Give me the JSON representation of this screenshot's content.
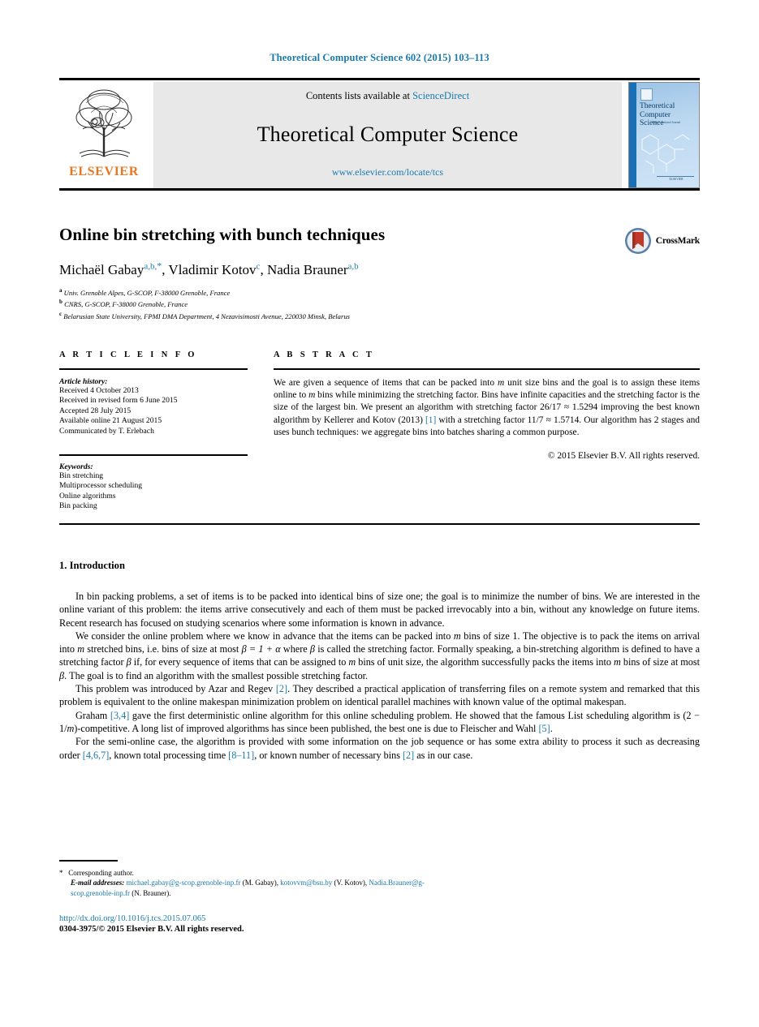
{
  "running_head": "Theoretical Computer Science 602 (2015) 103–113",
  "masthead": {
    "publisher": "ELSEVIER",
    "contents_prefix": "Contents lists available at",
    "contents_link": "ScienceDirect",
    "journal_name": "Theoretical Computer Science",
    "journal_url": "www.elsevier.com/locate/tcs",
    "cover": {
      "title_line1": "Theoretical",
      "title_line2": "Computer Science",
      "subtitle": "An International Journal",
      "footer": "ELSEVIER"
    }
  },
  "article": {
    "title": "Online bin stretching with bunch techniques",
    "authors": [
      {
        "name": "Michaël Gabay",
        "marks": "a,b,",
        "star": "*",
        "sep": ", "
      },
      {
        "name": "Vladimir Kotov",
        "marks": "c",
        "star": "",
        "sep": ", "
      },
      {
        "name": "Nadia Brauner",
        "marks": "a,b",
        "star": "",
        "sep": ""
      }
    ],
    "affiliations": [
      {
        "mark": "a",
        "text": "Univ. Grenoble Alpes, G-SCOP, F-38000 Grenoble, France"
      },
      {
        "mark": "b",
        "text": "CNRS, G-SCOP, F-38000 Grenoble, France"
      },
      {
        "mark": "c",
        "text": "Belarusian State University, FPMI DMA Department, 4 Nezavisimosti Avenue, 220030 Minsk, Belarus"
      }
    ],
    "crossmark_label": "CrossMark"
  },
  "info": {
    "heading": "A R T I C L E   I N F O",
    "history_label": "Article history:",
    "history": [
      "Received 4 October 2013",
      "Received in revised form 6 June 2015",
      "Accepted 28 July 2015",
      "Available online 21 August 2015",
      "Communicated by T. Erlebach"
    ],
    "keywords_label": "Keywords:",
    "keywords": [
      "Bin stretching",
      "Multiprocessor scheduling",
      "Online algorithms",
      "Bin packing"
    ]
  },
  "abstract": {
    "heading": "A B S T R A C T",
    "part1": "We are given a sequence of items that can be packed into ",
    "m1": "m",
    "part2": " unit size bins and the goal is to assign these items online to ",
    "m2": "m",
    "part3": " bins while minimizing the stretching factor. Bins have infinite capacities and the stretching factor is the size of the largest bin. We present an algorithm with stretching factor 26/17 ≈ 1.5294 improving the best known algorithm by Kellerer and Kotov (2013) ",
    "cite1": "[1]",
    "part4": " with a stretching factor 11/7 ≈ 1.5714. Our algorithm has 2 stages and uses bunch techniques: we aggregate bins into batches sharing a common purpose.",
    "copyright": "© 2015 Elsevier B.V. All rights reserved."
  },
  "body": {
    "section_heading": "1. Introduction",
    "p1": "In bin packing problems, a set of items is to be packed into identical bins of size one; the goal is to minimize the number of bins. We are interested in the online variant of this problem: the items arrive consecutively and each of them must be packed irrevocably into a bin, without any knowledge on future items. Recent research has focused on studying scenarios where some information is known in advance.",
    "p2_a": "We consider the online problem where we know in advance that the items can be packed into ",
    "p2_m1": "m",
    "p2_b": " bins of size 1. The objective is to pack the items on arrival into ",
    "p2_m2": "m",
    "p2_c": " stretched bins, i.e. bins of size at most ",
    "p2_eq": "β = 1 + α",
    "p2_d": " where ",
    "p2_beta1": "β",
    "p2_e": " is called the stretching factor. Formally speaking, a bin-stretching algorithm is defined to have a stretching factor ",
    "p2_beta2": "β",
    "p2_f": " if, for every sequence of items that can be assigned to ",
    "p2_m3": "m",
    "p2_g": " bins of unit size, the algorithm successfully packs the items into ",
    "p2_m4": "m",
    "p2_h": " bins of size at most ",
    "p2_beta3": "β",
    "p2_i": ". The goal is to find an algorithm with the smallest possible stretching factor.",
    "p3_a": "This problem was introduced by Azar and Regev ",
    "p3_cite": "[2]",
    "p3_b": ". They described a practical application of transferring files on a remote system and remarked that this problem is equivalent to the online makespan minimization problem on identical parallel machines with known value of the optimal makespan.",
    "p4_a": "Graham ",
    "p4_cite": "[3,4]",
    "p4_b": " gave the first deterministic online algorithm for this online scheduling problem. He showed that the famous List scheduling algorithm is (2 − 1/",
    "p4_m": "m",
    "p4_c": ")-competitive. A long list of improved algorithms has since been published, the best one is due to Fleischer and Wahl ",
    "p4_cite2": "[5]",
    "p4_d": ".",
    "p5_a": "For the semi-online case, the algorithm is provided with some information on the job sequence or has some extra ability to process it such as decreasing order ",
    "p5_cite1": "[4,6,7]",
    "p5_b": ", known total processing time ",
    "p5_cite2": "[8–11]",
    "p5_c": ", or known number of necessary bins ",
    "p5_cite3": "[2]",
    "p5_d": " as in our case."
  },
  "footnotes": {
    "star": "*",
    "corresponding": "Corresponding author.",
    "email_label": "E-mail addresses:",
    "emails": [
      {
        "address": "michael.gabay@g-scop.grenoble-inp.fr",
        "owner": " (M. Gabay), "
      },
      {
        "address": "kotovvm@bsu.by",
        "owner": " (V. Kotov), "
      },
      {
        "address": "Nadia.Brauner@g-scop.grenoble-inp.fr",
        "owner": " (N. Brauner)."
      }
    ]
  },
  "bottom": {
    "doi": "http://dx.doi.org/10.1016/j.tcs.2015.07.065",
    "issn": "0304-3975/© 2015 Elsevier B.V. All rights reserved."
  },
  "colors": {
    "link": "#1a7aab",
    "elsevier_orange": "#e87722",
    "cover_blue": "#9dc3e6"
  }
}
